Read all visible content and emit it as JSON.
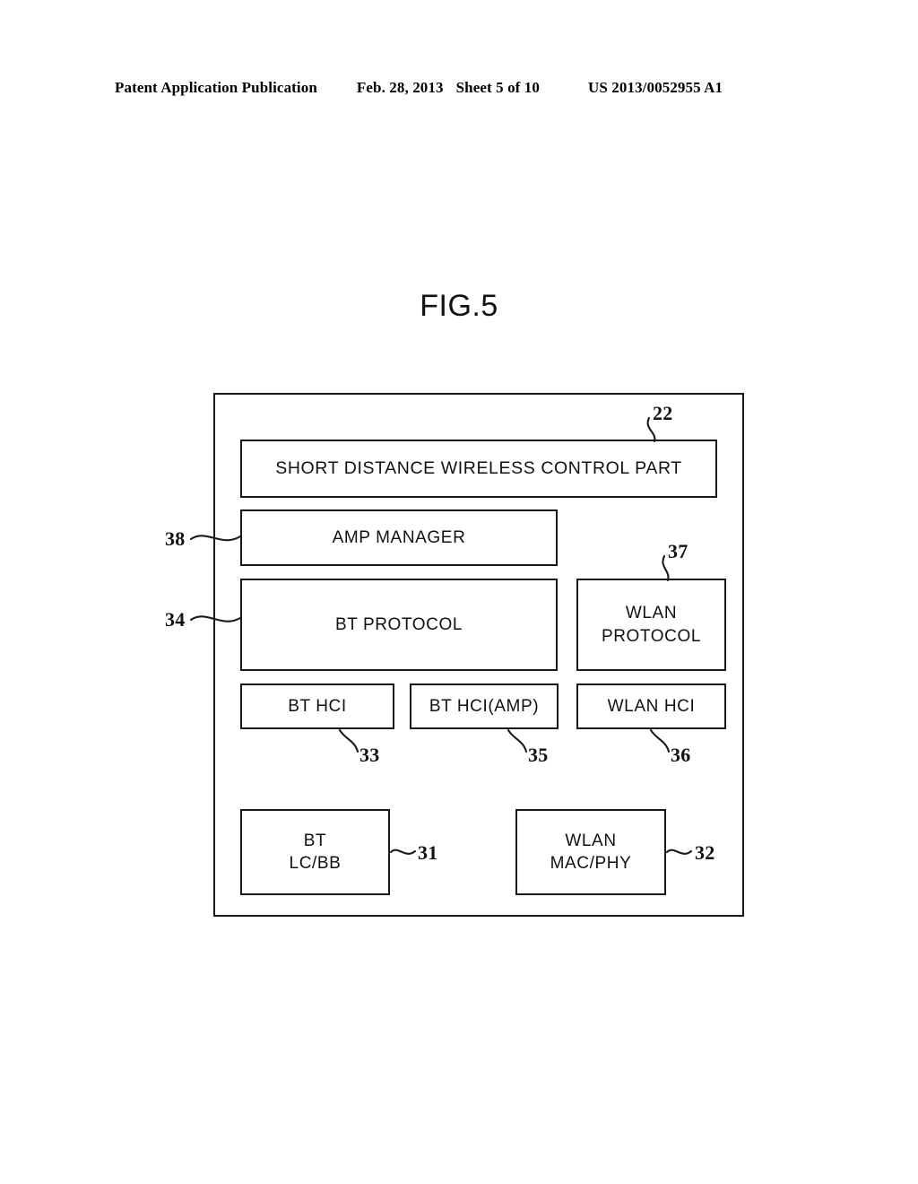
{
  "header": {
    "publication": "Patent Application Publication",
    "date": "Feb. 28, 2013",
    "sheet": "Sheet 5 of 10",
    "patent_number": "US 2013/0052955 A1"
  },
  "figure": {
    "title": "FIG.5"
  },
  "diagram": {
    "type": "block-diagram",
    "outer_container": {
      "name": "short-distance-wireless-module",
      "reference": "22"
    },
    "blocks": [
      {
        "id": "control",
        "label": "SHORT DISTANCE WIRELESS CONTROL PART",
        "reference": "22"
      },
      {
        "id": "ampmgr",
        "label": "AMP MANAGER",
        "reference": "38"
      },
      {
        "id": "btproto",
        "label": "BT PROTOCOL",
        "reference": "34"
      },
      {
        "id": "wlanpro",
        "label": "WLAN\nPROTOCOL",
        "reference": "37"
      },
      {
        "id": "bthci",
        "label": "BT HCI",
        "reference": "33"
      },
      {
        "id": "bthciamp",
        "label": "BT HCI(AMP)",
        "reference": "35"
      },
      {
        "id": "wlanhci",
        "label": "WLAN HCI",
        "reference": "36"
      },
      {
        "id": "btlcbb",
        "label": "BT\nLC/BB",
        "reference": "31"
      },
      {
        "id": "wlanmac",
        "label": "WLAN\nMAC/PHY",
        "reference": "32"
      }
    ],
    "labels": {
      "control": "SHORT DISTANCE WIRELESS CONTROL PART",
      "ampmgr": "AMP MANAGER",
      "btproto": "BT PROTOCOL",
      "wlanpro_line1": "WLAN",
      "wlanpro_line2": "PROTOCOL",
      "bthci": "BT HCI",
      "bthciamp": "BT HCI(AMP)",
      "wlanhci": "WLAN HCI",
      "btlcbb_line1": "BT",
      "btlcbb_line2": "LC/BB",
      "wlanmac_line1": "WLAN",
      "wlanmac_line2": "MAC/PHY"
    },
    "references": {
      "r22": "22",
      "r31": "31",
      "r32": "32",
      "r33": "33",
      "r34": "34",
      "r35": "35",
      "r36": "36",
      "r37": "37",
      "r38": "38"
    }
  },
  "colors": {
    "ink": "#1a1a1a",
    "paper": "#ffffff"
  }
}
